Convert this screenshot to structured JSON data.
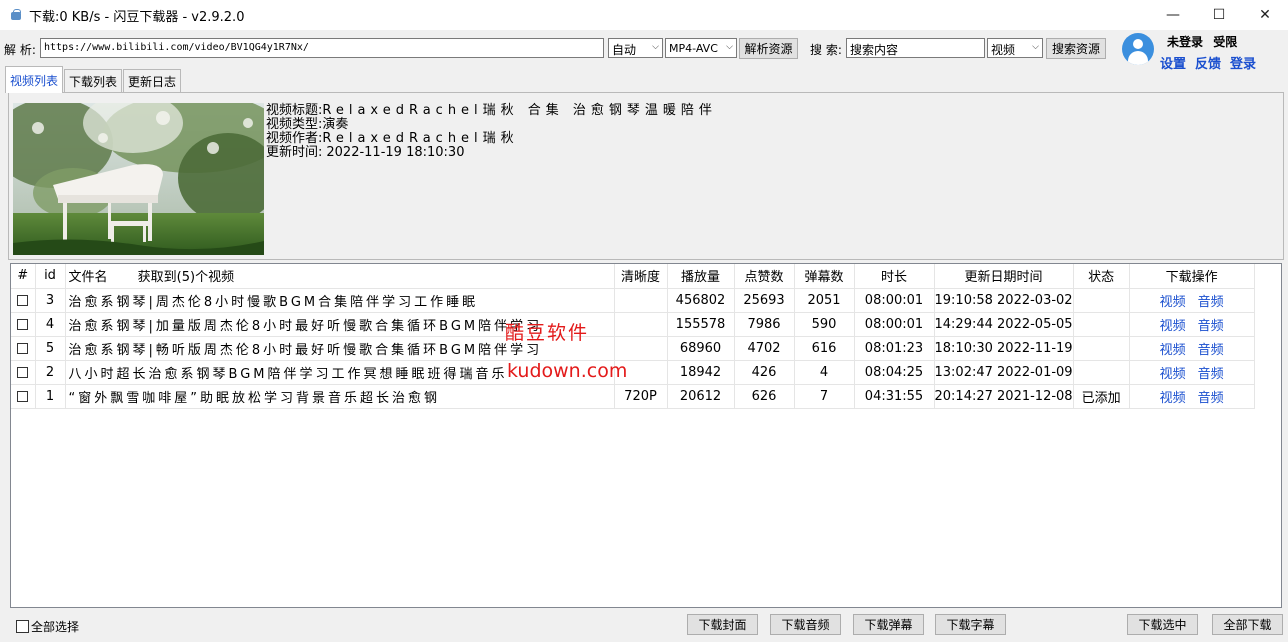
{
  "window": {
    "title": "下载:0 KB/s - 闪豆下载器 - v2.9.2.0",
    "minimize": "—",
    "maximize": "☐",
    "close": "✕"
  },
  "toolbar": {
    "parse_label": "解 析:",
    "url_value": "https://www.bilibili.com/video/BV1QG4y1R7Nx/",
    "quality_select": "自动",
    "format_select": "MP4-AVC",
    "parse_button": "解析资源",
    "search_label": "搜 索:",
    "search_value": "搜索内容",
    "search_type": "视频",
    "search_button": "搜索资源"
  },
  "user": {
    "status": "未登录",
    "limit": "受限",
    "settings": "设置",
    "feedback": "反馈",
    "login": "登录"
  },
  "tabs": [
    "视频列表",
    "下载列表",
    "更新日志"
  ],
  "info": {
    "title_label": "视频标题:",
    "title_value": "RelaxedRachel瑞秋 合集 治愈钢琴温暖陪伴",
    "type_label": "视频类型:",
    "type_value": "演奏",
    "author_label": "视频作者:",
    "author_value": "RelaxedRachel瑞秋",
    "updated_label": "更新时间:",
    "updated_value": "2022-11-19 18:10:30"
  },
  "table": {
    "headers": {
      "hash": "#",
      "id": "id",
      "name": "文件名",
      "found": "获取到(5)个视频",
      "quality": "清晰度",
      "plays": "播放量",
      "likes": "点赞数",
      "danmaku": "弹幕数",
      "duration": "时长",
      "updated": "更新日期时间",
      "status": "状态",
      "actions": "下载操作"
    },
    "rows": [
      {
        "id": "3",
        "name": "治愈系钢琴|周杰伦8小时慢歌BGM合集陪伴学习工作睡眠",
        "quality": "",
        "plays": "456802",
        "likes": "25693",
        "danmaku": "2051",
        "duration": "08:00:01",
        "updated": "2022-03-02 19:10:58",
        "status": "",
        "video": "视频",
        "audio": "音频"
      },
      {
        "id": "4",
        "name": "治愈系钢琴|加量版周杰伦8小时最好听慢歌合集循环BGM陪伴学习",
        "quality": "",
        "plays": "155578",
        "likes": "7986",
        "danmaku": "590",
        "duration": "08:00:01",
        "updated": "2022-05-05 14:29:44",
        "status": "",
        "video": "视频",
        "audio": "音频"
      },
      {
        "id": "5",
        "name": "治愈系钢琴|畅听版周杰伦8小时最好听慢歌合集循环BGM陪伴学习",
        "quality": "",
        "plays": "68960",
        "likes": "4702",
        "danmaku": "616",
        "duration": "08:01:23",
        "updated": "2022-11-19 18:10:30",
        "status": "",
        "video": "视频",
        "audio": "音频"
      },
      {
        "id": "2",
        "name": "八小时超长治愈系钢琴BGM陪伴学习工作冥想睡眠班得瑞音乐",
        "quality": "",
        "plays": "18942",
        "likes": "426",
        "danmaku": "4",
        "duration": "08:04:25",
        "updated": "2022-01-09 13:02:47",
        "status": "",
        "video": "视频",
        "audio": "音频"
      },
      {
        "id": "1",
        "name": "“窗外飘雪咖啡屋”助眠放松学习背景音乐超长治愈钢",
        "quality": "720P",
        "plays": "20612",
        "likes": "626",
        "danmaku": "7",
        "duration": "04:31:55",
        "updated": "2021-12-08 20:14:27",
        "status": "已添加",
        "video": "视频",
        "audio": "音频"
      }
    ]
  },
  "watermark": {
    "line1": "酷豆软件",
    "line2": "kudown.com"
  },
  "footer": {
    "select_all": "全部选择",
    "download_cover": "下载封面",
    "download_audio": "下载音频",
    "download_danmaku": "下载弹幕",
    "download_subtitle": "下载字幕",
    "download_selected": "下载选中",
    "download_all": "全部下载"
  }
}
